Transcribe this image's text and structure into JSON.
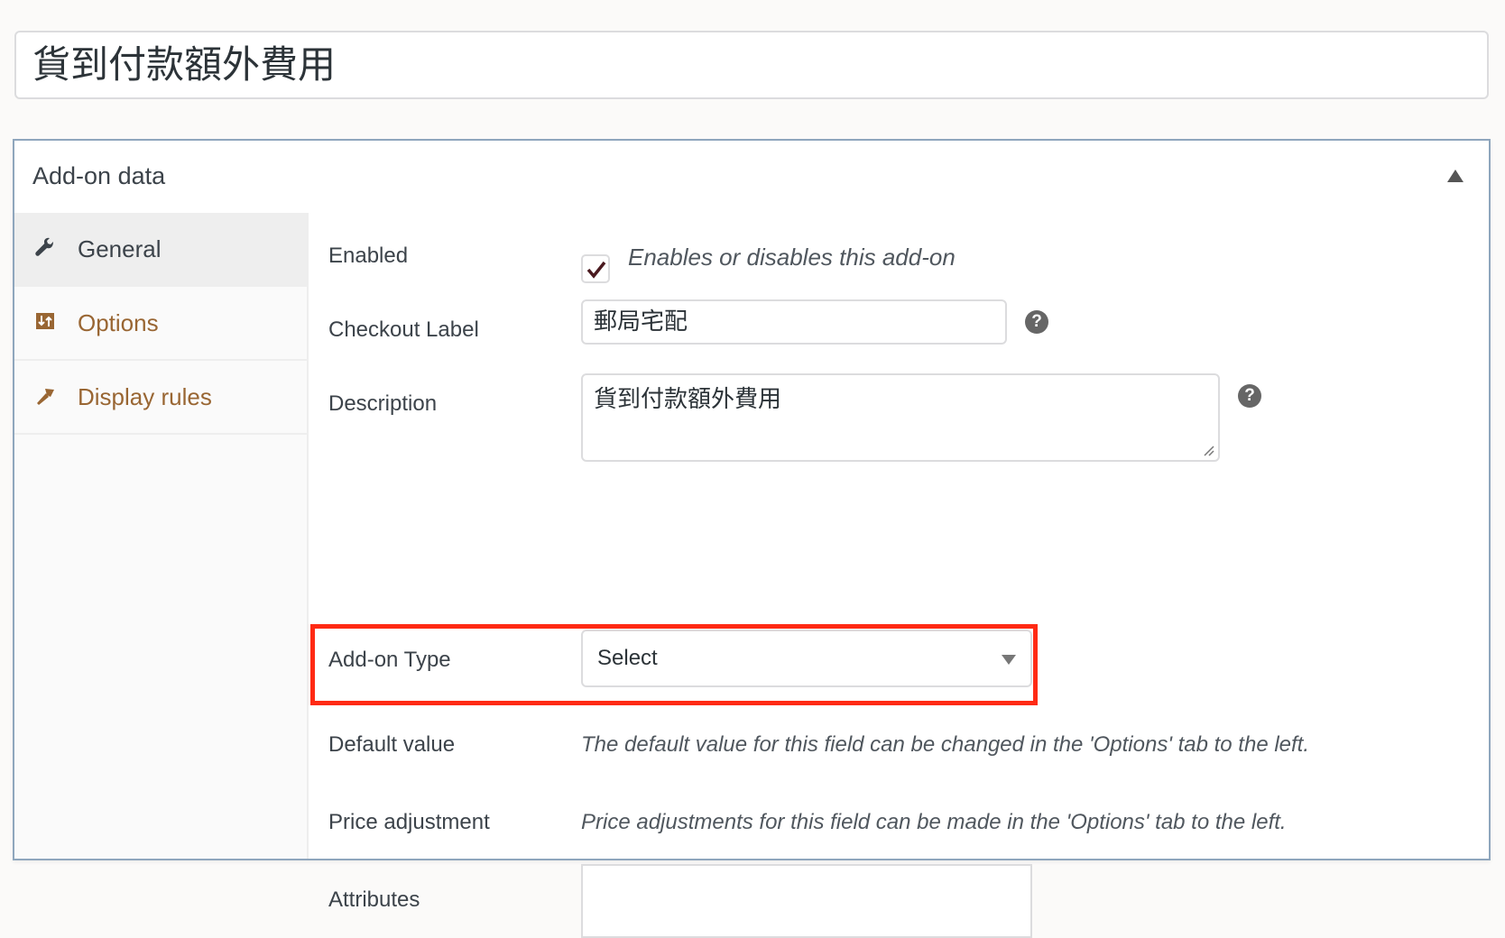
{
  "title_input": {
    "value": "貨到付款額外費用"
  },
  "postbox": {
    "title": "Add-on data",
    "toggle_icon": "triangle-up-icon"
  },
  "sidebar": {
    "tabs": [
      {
        "label": "General",
        "icon": "wrench-icon",
        "active": true
      },
      {
        "label": "Options",
        "icon": "sliders-icon",
        "active": false
      },
      {
        "label": "Display rules",
        "icon": "brush-icon",
        "active": false
      }
    ]
  },
  "fields": {
    "enabled": {
      "label": "Enabled",
      "checked": true,
      "description": "Enables or disables this add-on"
    },
    "checkout_label": {
      "label": "Checkout Label",
      "value": "郵局宅配",
      "help_icon": "question-circle-icon"
    },
    "description": {
      "label": "Description",
      "value": "貨到付款額外費用",
      "help_icon": "question-circle-icon"
    },
    "addon_type": {
      "label": "Add-on Type",
      "selected": "Select"
    },
    "default_value": {
      "label": "Default value",
      "note": "The default value for this field can be changed in the 'Options' tab to the left."
    },
    "price_adjustment": {
      "label": "Price adjustment",
      "note": "Price adjustments for this field can be made in the 'Options' tab to the left."
    },
    "attributes": {
      "label": "Attributes",
      "value": ""
    }
  },
  "colors": {
    "accent_link": "#996633",
    "highlight": "#ff2a14",
    "checkmark": "#4a1a1f"
  }
}
